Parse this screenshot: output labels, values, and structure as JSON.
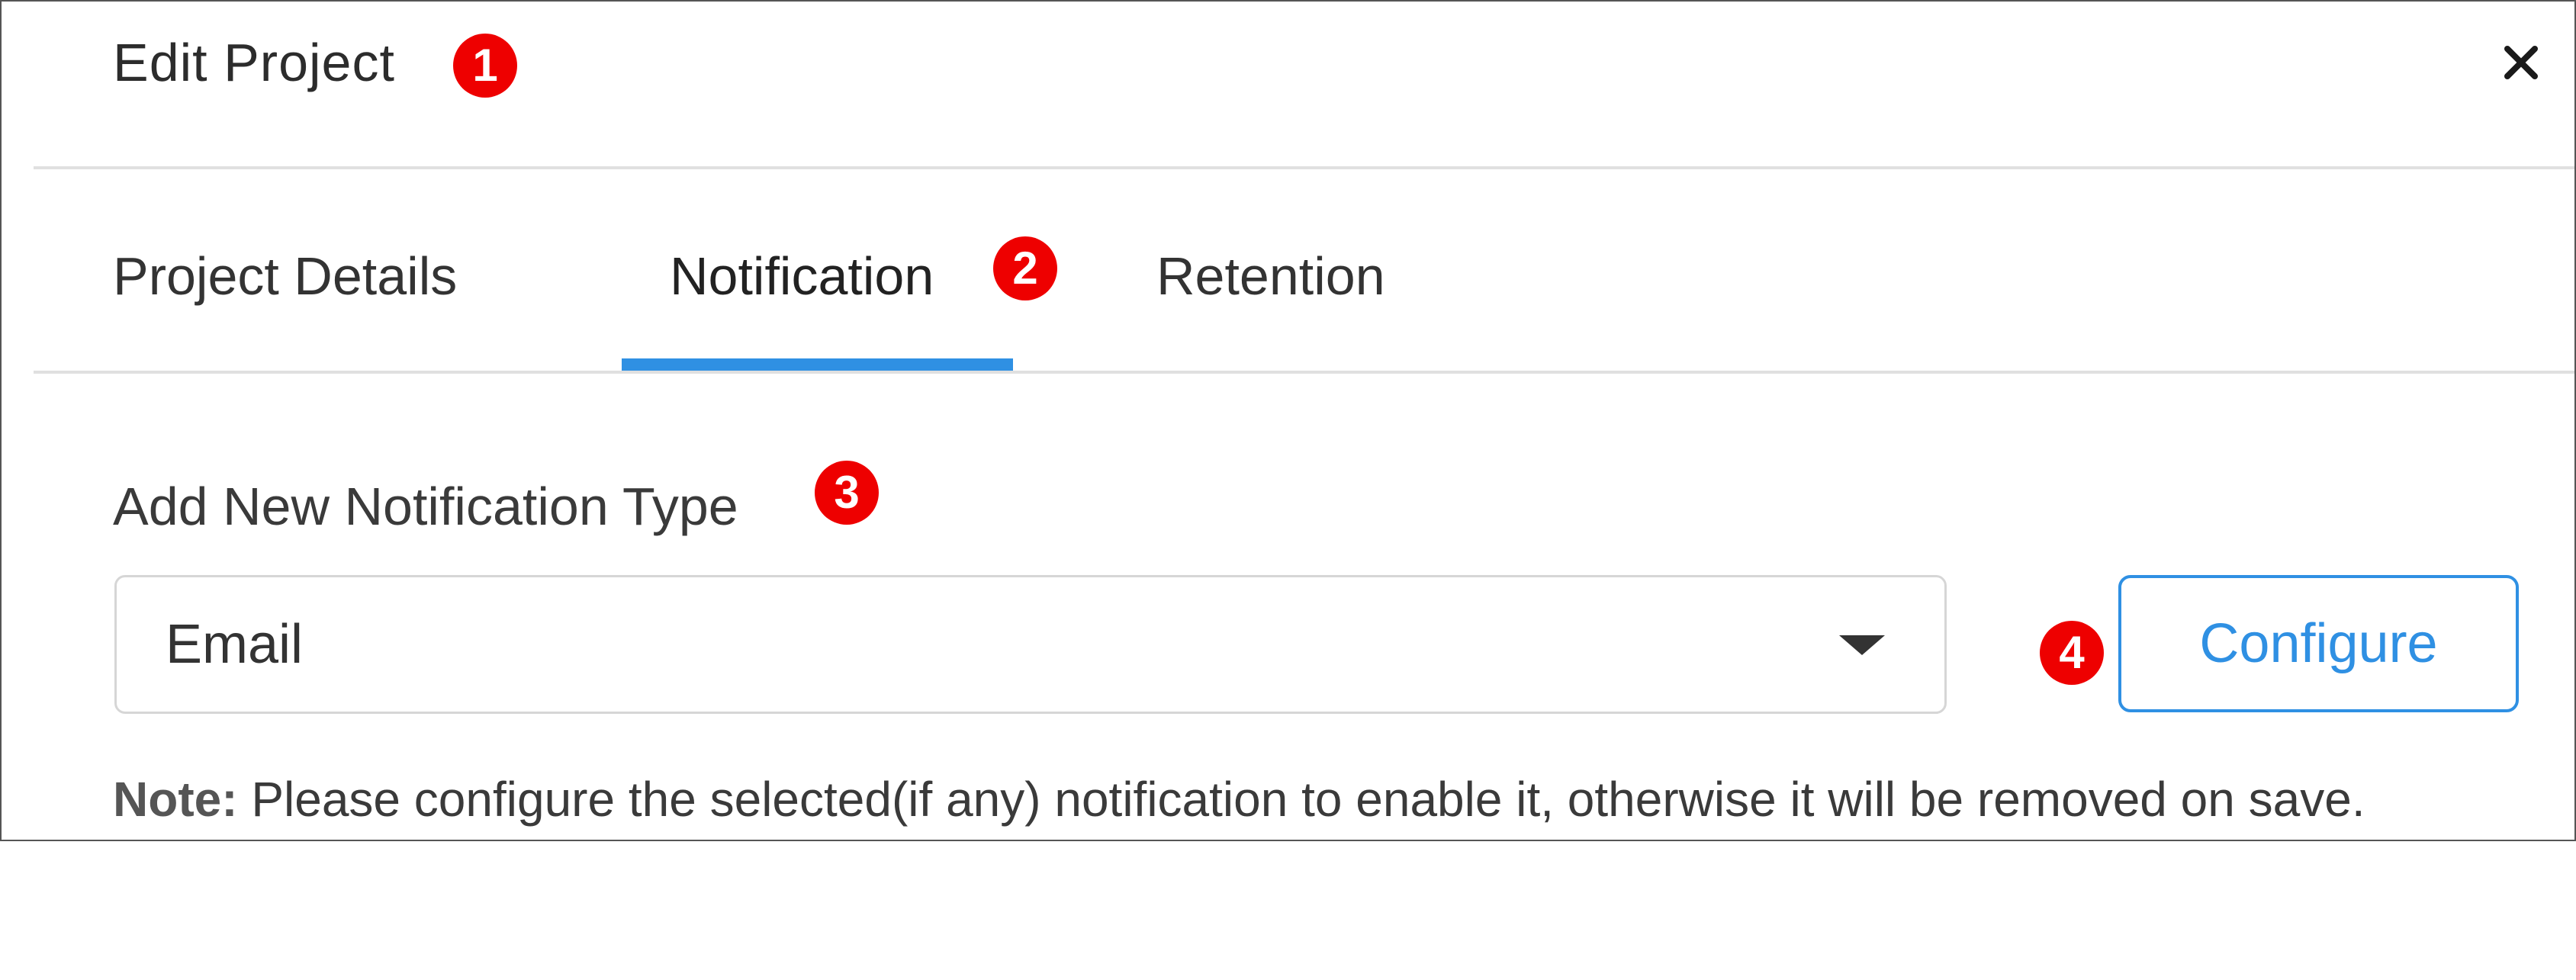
{
  "dialog": {
    "title": "Edit Project",
    "close_icon": "close-icon"
  },
  "tabs": [
    {
      "label": "Project Details",
      "active": false
    },
    {
      "label": "Notification",
      "active": true
    },
    {
      "label": "Retention",
      "active": false
    }
  ],
  "notification": {
    "section_label": "Add New Notification Type",
    "selected_type": "Email",
    "configure_label": "Configure",
    "note_prefix": "Note:",
    "note_text": " Please configure the selected(if any) notification to enable it, otherwise it will be removed on save."
  },
  "badges": [
    "1",
    "2",
    "3",
    "4"
  ],
  "colors": {
    "accent": "#2f90e3",
    "badge": "#ee0000",
    "border": "#d6d6d6"
  }
}
